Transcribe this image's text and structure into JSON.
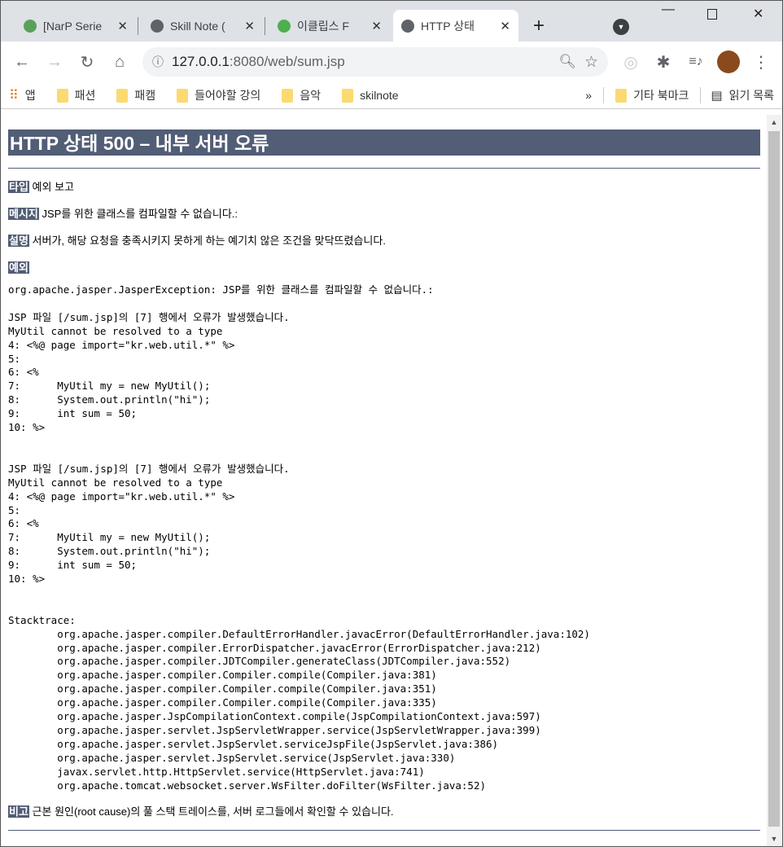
{
  "tabs": [
    {
      "title": "[NarP Serie",
      "color": "#5aa05a"
    },
    {
      "title": "Skill Note (",
      "color": "#5f6368"
    },
    {
      "title": "이클립스 F",
      "color": "#4caf50"
    },
    {
      "title": "HTTP 상태",
      "color": "#5f6368",
      "active": true
    }
  ],
  "new_tab": "+",
  "url": {
    "host": "127.0.0.1",
    "path": ":8080/web/sum.jsp"
  },
  "bookmarks": [
    "앱",
    "패션",
    "패캠",
    "들어야할 강의",
    "음악",
    "skilnote"
  ],
  "bookmarks_more": "»",
  "other_bookmarks": "기타 북마크",
  "reading_list": "읽기 목록",
  "page": {
    "title": "HTTP 상태 500 – 내부 서버 오류",
    "type_label": "타입",
    "type_value": "예외 보고",
    "message_label": "메시지",
    "message_value": "JSP를 위한 클래스를 컴파일할 수 없습니다.:",
    "desc_label": "설명",
    "desc_value": "서버가, 해당 요청을 충족시키지 못하게 하는 예기치 않은 조건을 맞닥뜨렸습니다.",
    "exception_label": "예외",
    "exception_trace": "org.apache.jasper.JasperException: JSP를 위한 클래스를 컴파일할 수 없습니다.:\n\nJSP 파일 [/sum.jsp]의 [7] 행에서 오류가 발생했습니다.\nMyUtil cannot be resolved to a type\n4: <%@ page import=\"kr.web.util.*\" %>\n5: \n6: <%\n7: \tMyUtil my = new MyUtil();\n8: \tSystem.out.println(\"hi\");\n9: \tint sum = 50;\n10: %>\n\n\nJSP 파일 [/sum.jsp]의 [7] 행에서 오류가 발생했습니다.\nMyUtil cannot be resolved to a type\n4: <%@ page import=\"kr.web.util.*\" %>\n5: \n6: <%\n7: \tMyUtil my = new MyUtil();\n8: \tSystem.out.println(\"hi\");\n9: \tint sum = 50;\n10: %>\n\n\nStacktrace:\n\torg.apache.jasper.compiler.DefaultErrorHandler.javacError(DefaultErrorHandler.java:102)\n\torg.apache.jasper.compiler.ErrorDispatcher.javacError(ErrorDispatcher.java:212)\n\torg.apache.jasper.compiler.JDTCompiler.generateClass(JDTCompiler.java:552)\n\torg.apache.jasper.compiler.Compiler.compile(Compiler.java:381)\n\torg.apache.jasper.compiler.Compiler.compile(Compiler.java:351)\n\torg.apache.jasper.compiler.Compiler.compile(Compiler.java:335)\n\torg.apache.jasper.JspCompilationContext.compile(JspCompilationContext.java:597)\n\torg.apache.jasper.servlet.JspServletWrapper.service(JspServletWrapper.java:399)\n\torg.apache.jasper.servlet.JspServlet.serviceJspFile(JspServlet.java:386)\n\torg.apache.jasper.servlet.JspServlet.service(JspServlet.java:330)\n\tjavax.servlet.http.HttpServlet.service(HttpServlet.java:741)\n\torg.apache.tomcat.websocket.server.WsFilter.doFilter(WsFilter.java:52)",
    "note_label": "비고",
    "note_value": "근본 원인(root cause)의 풀 스택 트레이스를, 서버 로그들에서 확인할 수 있습니다."
  }
}
